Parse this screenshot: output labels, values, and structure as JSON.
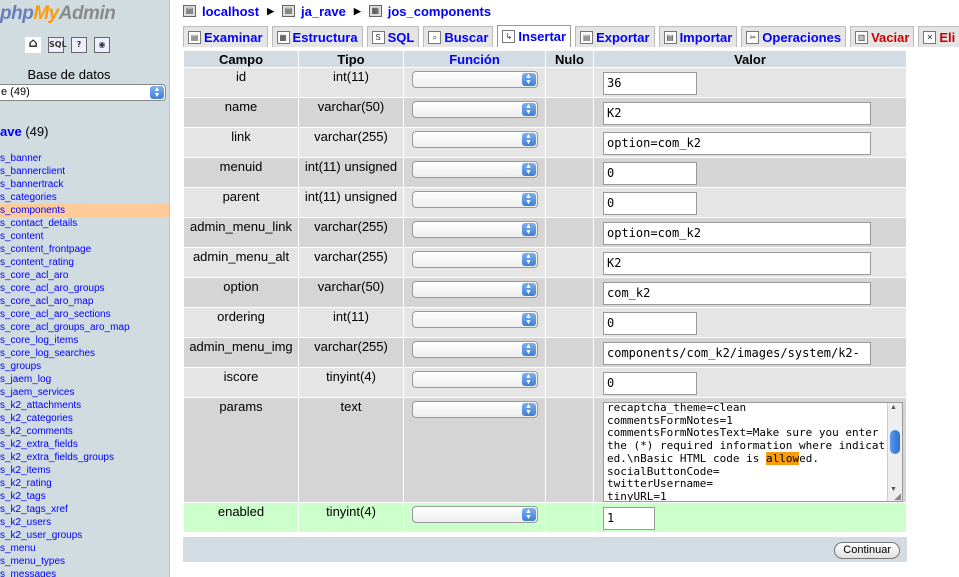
{
  "sidebar": {
    "logo": {
      "php": "php",
      "my": "My",
      "admin": "Admin"
    },
    "quick_icons": [
      "home-icon",
      "sql-icon",
      "query-icon",
      "docs-icon"
    ],
    "db_label": "Base de datos",
    "db_select_value": "e (49)",
    "db_title_name": "ave",
    "db_title_count": " (49)",
    "tables": [
      "s_banner",
      "s_bannerclient",
      "s_bannertrack",
      "s_categories",
      "s_components",
      "s_contact_details",
      "s_content",
      "s_content_frontpage",
      "s_content_rating",
      "s_core_acl_aro",
      "s_core_acl_aro_groups",
      "s_core_acl_aro_map",
      "s_core_acl_aro_sections",
      "s_core_acl_groups_aro_map",
      "s_core_log_items",
      "s_core_log_searches",
      "s_groups",
      "s_jaem_log",
      "s_jaem_services",
      "s_k2_attachments",
      "s_k2_categories",
      "s_k2_comments",
      "s_k2_extra_fields",
      "s_k2_extra_fields_groups",
      "s_k2_items",
      "s_k2_rating",
      "s_k2_tags",
      "s_k2_tags_xref",
      "s_k2_users",
      "s_k2_user_groups",
      "s_menu",
      "s_menu_types",
      "s_messages"
    ],
    "active_table_index": 4
  },
  "breadcrumb": {
    "server": "localhost",
    "database": "ja_rave",
    "table": "jos_components"
  },
  "tabs": [
    {
      "label": "Examinar",
      "icon": "browse-icon"
    },
    {
      "label": "Estructura",
      "icon": "structure-icon"
    },
    {
      "label": "SQL",
      "icon": "sql-icon"
    },
    {
      "label": "Buscar",
      "icon": "search-icon"
    },
    {
      "label": "Insertar",
      "icon": "insert-icon"
    },
    {
      "label": "Exportar",
      "icon": "export-icon"
    },
    {
      "label": "Importar",
      "icon": "import-icon"
    },
    {
      "label": "Operaciones",
      "icon": "operations-icon"
    },
    {
      "label": "Vaciar",
      "icon": "empty-icon"
    },
    {
      "label": "Eli",
      "icon": "drop-icon"
    }
  ],
  "active_tab": "Insertar",
  "columns": {
    "campo": "Campo",
    "tipo": "Tipo",
    "funcion": "Función",
    "nulo": "Nulo",
    "valor": "Valor"
  },
  "rows": [
    {
      "campo": "id",
      "tipo": "int(11)",
      "valor": "36"
    },
    {
      "campo": "name",
      "tipo": "varchar(50)",
      "valor": "K2"
    },
    {
      "campo": "link",
      "tipo": "varchar(255)",
      "valor": "option=com_k2"
    },
    {
      "campo": "menuid",
      "tipo": "int(11) unsigned",
      "valor": "0"
    },
    {
      "campo": "parent",
      "tipo": "int(11) unsigned",
      "valor": "0"
    },
    {
      "campo": "admin_menu_link",
      "tipo": "varchar(255)",
      "valor": "option=com_k2"
    },
    {
      "campo": "admin_menu_alt",
      "tipo": "varchar(255)",
      "valor": "K2"
    },
    {
      "campo": "option",
      "tipo": "varchar(50)",
      "valor": "com_k2"
    },
    {
      "campo": "ordering",
      "tipo": "int(11)",
      "valor": "0"
    },
    {
      "campo": "admin_menu_img",
      "tipo": "varchar(255)",
      "valor": "components/com_k2/images/system/k2-"
    },
    {
      "campo": "iscore",
      "tipo": "tinyint(4)",
      "valor": "0"
    },
    {
      "campo": "params",
      "tipo": "text",
      "valor_before": "recaptcha_theme=clean\ncommentsFormNotes=1\ncommentsFormNotesText=Make sure you enter the (*) required information where indicated.\\nBasic HTML code is ",
      "valor_highlight": "allow",
      "valor_after": "ed.\nsocialButtonCode=\ntwitterUsername=\ntinyURL=1"
    },
    {
      "campo": "enabled",
      "tipo": "tinyint(4)",
      "valor": "1"
    }
  ],
  "continue_button": "Continuar"
}
